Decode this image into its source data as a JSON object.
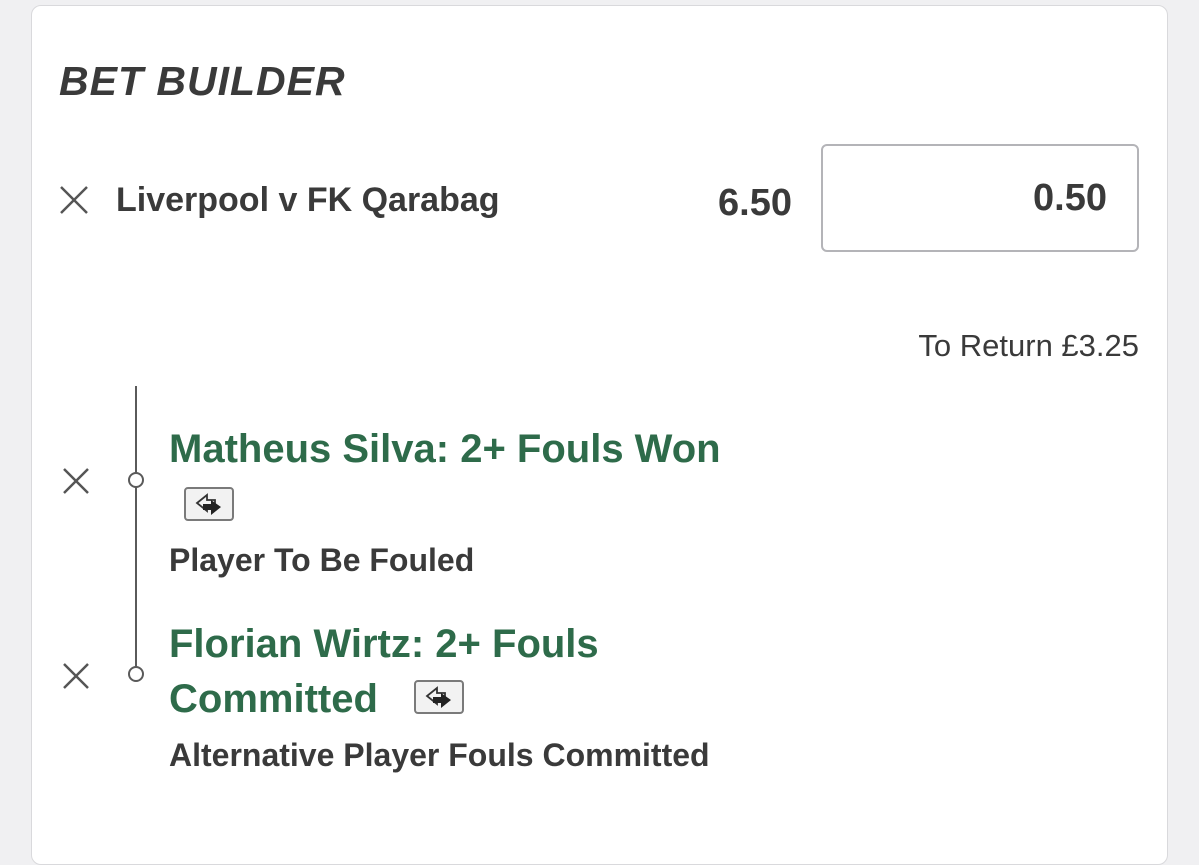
{
  "header": {
    "title": "BET BUILDER"
  },
  "event": {
    "name": "Liverpool v FK Qarabag",
    "odds": "6.50",
    "stake": "0.50",
    "to_return": "To Return £3.25"
  },
  "selections": [
    {
      "title": "Matheus Silva: 2+ Fouls Won",
      "market": "Player To Be Fouled",
      "icon": "swap-icon"
    },
    {
      "title_line1": "Florian Wirtz: 2+ Fouls",
      "title_line2": "Committed",
      "market": "Alternative Player Fouls Committed",
      "icon": "swap-icon"
    }
  ],
  "colors": {
    "accent_green": "#2e6b4a",
    "text_dark": "#3a3a3a",
    "background": "#f0f0f2"
  }
}
